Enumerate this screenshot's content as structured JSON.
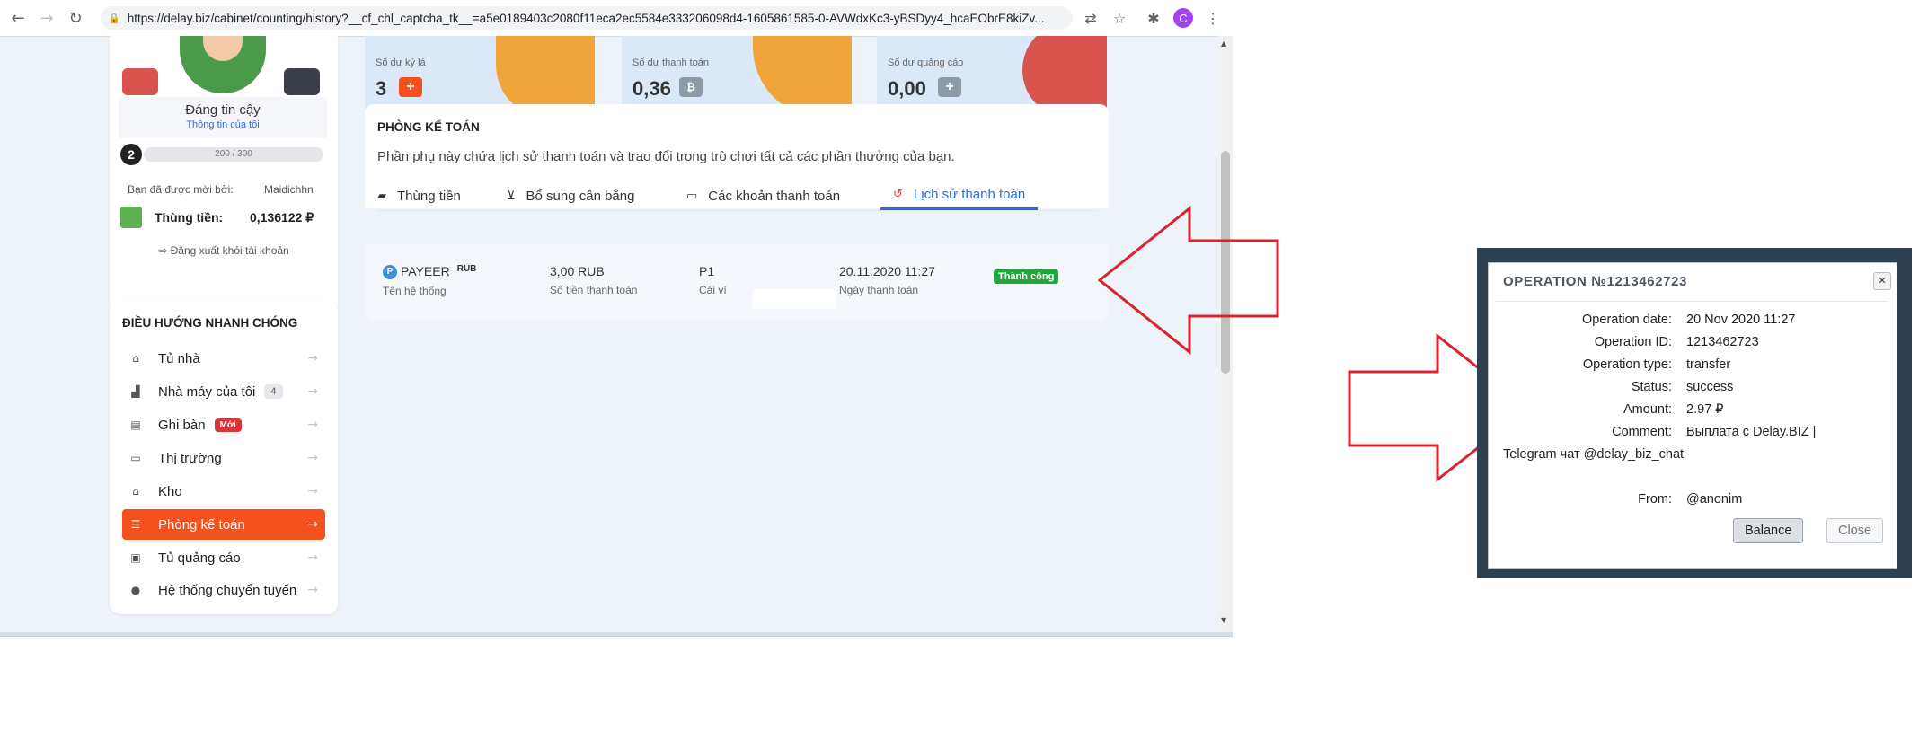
{
  "browser": {
    "url": "https://delay.biz/cabinet/counting/history?__cf_chl_captcha_tk__=a5e0189403c2080f11eca2ec5584e333206098d4-1605861585-0-AVWdxKc3-yBSDyy4_hcaEObrE8kiZv...",
    "avatar_letter": "C"
  },
  "profile": {
    "trust_title": "Đáng tin cậy",
    "trust_link": "Thông tin của tôi",
    "level": "2",
    "xp": "200 / 300",
    "invited_label": "Bạn đã được mời bởi:",
    "invited_value": "Maidichhn",
    "safe_label": "Thùng tiền:",
    "safe_value": "0,136122 ₽",
    "logout": "Đăng xuất khỏi tài khoản"
  },
  "nav": {
    "title": "ĐIỀU HƯỚNG NHANH CHÓNG",
    "items": [
      {
        "label": "Tủ nhà",
        "icon": "home-icon"
      },
      {
        "label": "Nhà máy của tôi",
        "icon": "factory-icon",
        "count": "4"
      },
      {
        "label": "Ghi bàn",
        "icon": "score-icon",
        "badge": "Mới"
      },
      {
        "label": "Thị trường",
        "icon": "market-icon"
      },
      {
        "label": "Kho",
        "icon": "warehouse-icon"
      },
      {
        "label": "Phòng kế toán",
        "icon": "accounting-icon"
      },
      {
        "label": "Tủ quảng cáo",
        "icon": "ads-icon"
      },
      {
        "label": "Hệ thống chuyển tuyến",
        "icon": "referral-icon"
      }
    ]
  },
  "stats": [
    {
      "label": "Số dư ký lá",
      "value": "3",
      "color": "#f4511e"
    },
    {
      "label": "Số dư thanh toán",
      "value": "0,36",
      "color": "#8e9aa6"
    },
    {
      "label": "Số dư quảng cáo",
      "value": "0,00",
      "color": "#8e9aa6"
    }
  ],
  "accounting": {
    "title": "PHÒNG KẾ TOÁN",
    "description": "Phần phụ này chứa lịch sử thanh toán và trao đổi trong trò chơi tất cả các phần thưởng của bạn.",
    "tabs": [
      "Thùng tiền",
      "Bổ sung cân bằng",
      "Các khoản thanh toán",
      "Lịch sử thanh toán"
    ],
    "active_tab": "Lịch sử thanh toán",
    "row": {
      "system": "PAYEER",
      "currency_tag": "RUB",
      "system_label": "Tên hệ thống",
      "amount": "3,00 RUB",
      "amount_label": "Số tiền thanh toán",
      "wallet": "P1",
      "wallet_label": "Cái ví",
      "date": "20.11.2020 11:27",
      "date_label": "Ngày thanh toán",
      "status": "Thành công"
    }
  },
  "modal": {
    "title": "OPERATION №1213462723",
    "rows": [
      {
        "key": "Operation date:",
        "value": "20 Nov 2020 11:27"
      },
      {
        "key": "Operation ID:",
        "value": "1213462723"
      },
      {
        "key": "Operation type:",
        "value": "transfer"
      },
      {
        "key": "Status:",
        "value": "success"
      },
      {
        "key": "Amount:",
        "value": "2.97 ₽"
      }
    ],
    "comment_key": "Comment:",
    "comment_line1": "Выплата с Delay.BIZ |",
    "comment_line2": "Telegram чат @delay_biz_chat",
    "from_key": "From:",
    "from_value": "@anonim",
    "balance_button": "Balance",
    "close_button": "Close"
  },
  "colors": {
    "accent_orange": "#f4511e",
    "link_blue": "#2d6cdf",
    "success_green": "#22a63d",
    "annotation_red": "#d9232e"
  }
}
